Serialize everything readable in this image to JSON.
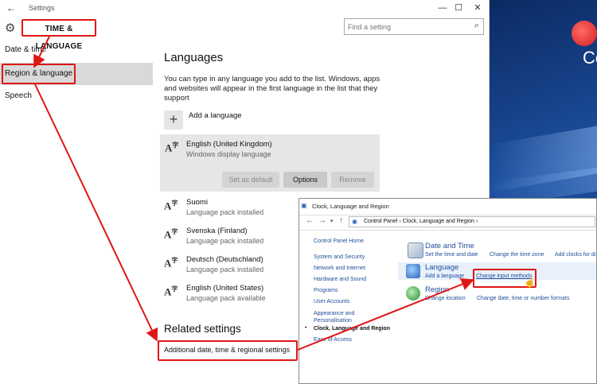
{
  "settings": {
    "window_title": "Settings",
    "section_title": "TIME & LANGUAGE",
    "search_placeholder": "Find a setting",
    "nav": [
      {
        "label": "Date & time"
      },
      {
        "label": "Region & language",
        "selected": true
      },
      {
        "label": "Speech"
      }
    ],
    "languages_heading": "Languages",
    "languages_description": "You can type in any language you add to the list. Windows, apps and websites will appear in the first language in the list that they support",
    "add_language": "Add a language",
    "languages": [
      {
        "name": "English (United Kingdom)",
        "status": "Windows display language",
        "selected": true
      },
      {
        "name": "Suomi",
        "status": "Language pack installed"
      },
      {
        "name": "Svenska (Finland)",
        "status": "Language pack installed"
      },
      {
        "name": "Deutsch (Deutschland)",
        "status": "Language pack installed"
      },
      {
        "name": "English (United States)",
        "status": "Language pack available"
      }
    ],
    "buttons": {
      "set_default": "Set as default",
      "options": "Options",
      "remove": "Remove"
    },
    "related_heading": "Related settings",
    "related_link": "Additional date, time & regional settings"
  },
  "control_panel": {
    "window_title": "Clock, Language and Region",
    "breadcrumb": "Control Panel  ›  Clock, Language and Region  ›",
    "sidebar": [
      "Control Panel Home",
      "System and Security",
      "Network and Internet",
      "Hardware and Sound",
      "Programs",
      "User Accounts",
      "Appearance and Personalisation",
      "Clock, Language and Region",
      "Ease of Access"
    ],
    "current_item": "Clock, Language and Region",
    "sections": [
      {
        "title": "Date and Time",
        "links": [
          "Set the time and date",
          "Change the time zone",
          "Add clocks for di"
        ]
      },
      {
        "title": "Language",
        "links": [
          "Add a language",
          "Change input methods"
        ]
      },
      {
        "title": "Region",
        "links": [
          "Change location",
          "Change date, time or number formats"
        ]
      }
    ]
  },
  "desktop": {
    "text": "Co"
  },
  "colors": {
    "highlight": "#e01616",
    "link": "#1f4f9a",
    "selected_bg": "#d9d9d9"
  }
}
